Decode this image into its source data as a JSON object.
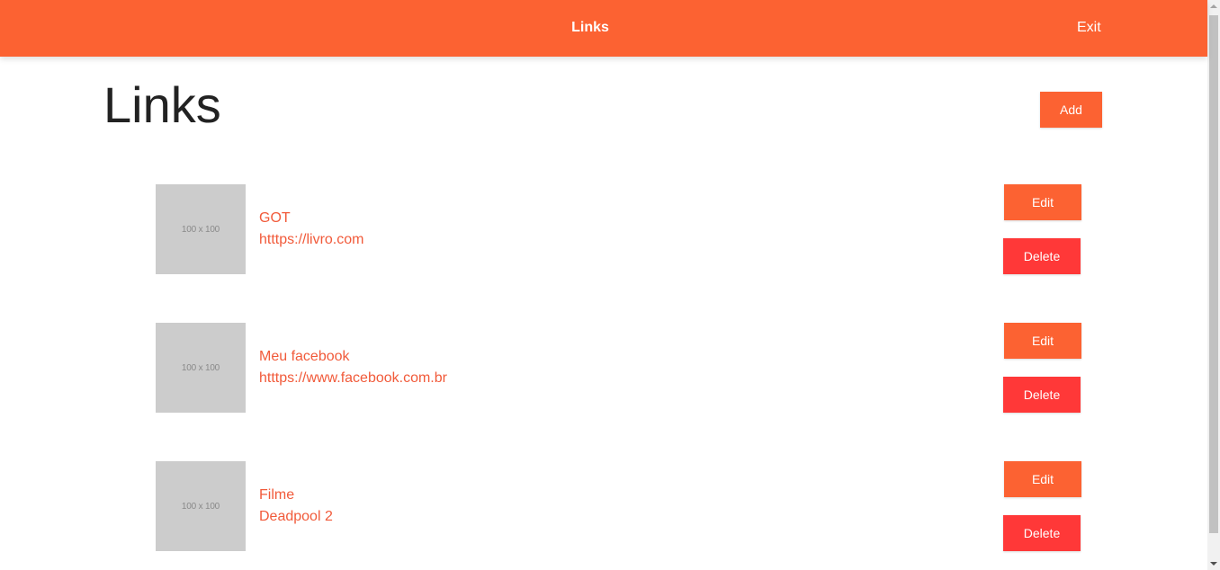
{
  "header": {
    "title": "Links",
    "exit_label": "Exit"
  },
  "page": {
    "title": "Links",
    "add_label": "Add"
  },
  "links": [
    {
      "thumbnail": "100 x 100",
      "title": "GOT",
      "url": "htttps://livro.com",
      "edit_label": "Edit",
      "delete_label": "Delete"
    },
    {
      "thumbnail": "100 x 100",
      "title": "Meu facebook",
      "url": "htttps://www.facebook.com.br",
      "edit_label": "Edit",
      "delete_label": "Delete"
    },
    {
      "thumbnail": "100 x 100",
      "title": "Filme",
      "url": "Deadpool 2",
      "edit_label": "Edit",
      "delete_label": "Delete"
    }
  ],
  "colors": {
    "accent": "#fc6232",
    "danger": "#ff3838",
    "link_text": "#f15a3a",
    "thumbnail_bg": "#cccccc"
  }
}
